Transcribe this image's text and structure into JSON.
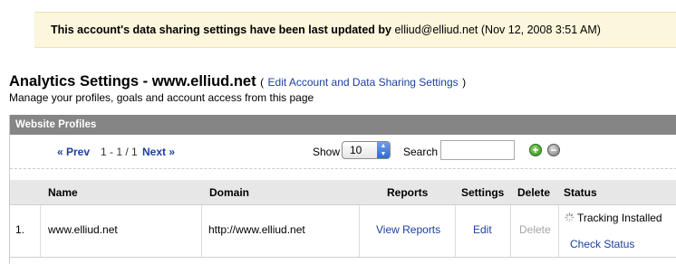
{
  "notice": {
    "lead": "This account's data sharing settings have been last updated by",
    "user": "elliud@elliud.net",
    "timestamp": "(Nov 12, 2008 3:51 AM)"
  },
  "header": {
    "title": "Analytics Settings - www.elliud.net",
    "paren_open": "(",
    "edit_link": "Edit Account and Data Sharing Settings",
    "paren_close": ")",
    "subtitle": "Manage your profiles, goals and account access from this page"
  },
  "panel": {
    "title": "Website Profiles",
    "pager": {
      "prev": "« Prev",
      "range": "1 - 1 / 1",
      "next": "Next »"
    },
    "show_label": "Show",
    "show_value": "10",
    "search_label": "Search",
    "search_value": "",
    "add_symbol": "+",
    "remove_symbol": "−"
  },
  "table": {
    "columns": [
      "Name",
      "Domain",
      "Reports",
      "Settings",
      "Delete",
      "Status"
    ],
    "rows": [
      {
        "index": "1.",
        "name": "www.elliud.net",
        "domain": "http://www.elliud.net",
        "reports": "View Reports",
        "settings": "Edit",
        "delete": "Delete",
        "status": "Tracking Installed",
        "status_link": "Check Status"
      }
    ]
  },
  "colors": {
    "notice_bg": "#fbf6dc",
    "header_bg": "#858585",
    "link": "#1c3f9e",
    "disabled": "#a5a5a5"
  }
}
